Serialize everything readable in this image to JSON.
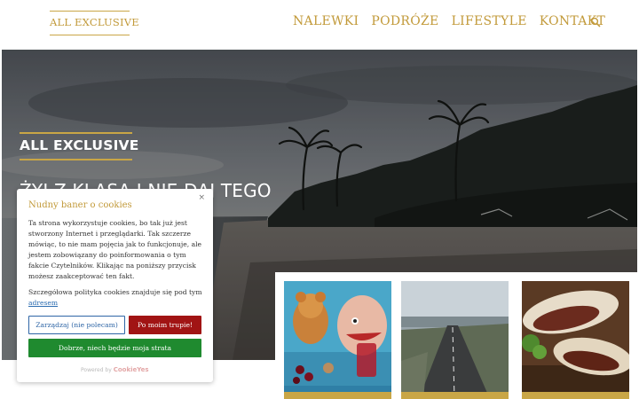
{
  "header": {
    "logo": "ALL EXCLUSIVE",
    "nav": [
      "NALEWKI",
      "PODRÓŻE",
      "LIFESTYLE",
      "KONTAKT"
    ],
    "search_icon": "search-icon"
  },
  "hero": {
    "kicker": "ALL EXCLUSIVE",
    "headline": "ŻYJ Z KLASĄ I NIE DAJ TEGO"
  },
  "cookie": {
    "title": "Nudny baner o cookies",
    "close": "×",
    "body": "Ta strona wykorzystuje cookies, bo tak już jest stworzony Internet i przeglądarki. Tak szczerze mówiąc, to nie mam pojęcia jak to funkcjonuje, ale jestem zobowiązany do poinformowania o tym fakcie Czytelników. Klikając na poniższy przycisk możesz zaakceptować ten fakt.",
    "policy_text": "Szczegółowa polityka cookies znajduje się pod tym",
    "policy_link": "adresem",
    "manage_label": "Zarządzaj (nie polecam)",
    "reject_label": "Po moim trupie!",
    "accept_label": "Dobrze, niech będzie moja strata",
    "powered_by": "Powered by",
    "powered_brand": "CookieYes"
  },
  "colors": {
    "gold": "#c9a646",
    "reject": "#a11414",
    "accept": "#1f8a2f",
    "manage": "#2f66a6"
  }
}
